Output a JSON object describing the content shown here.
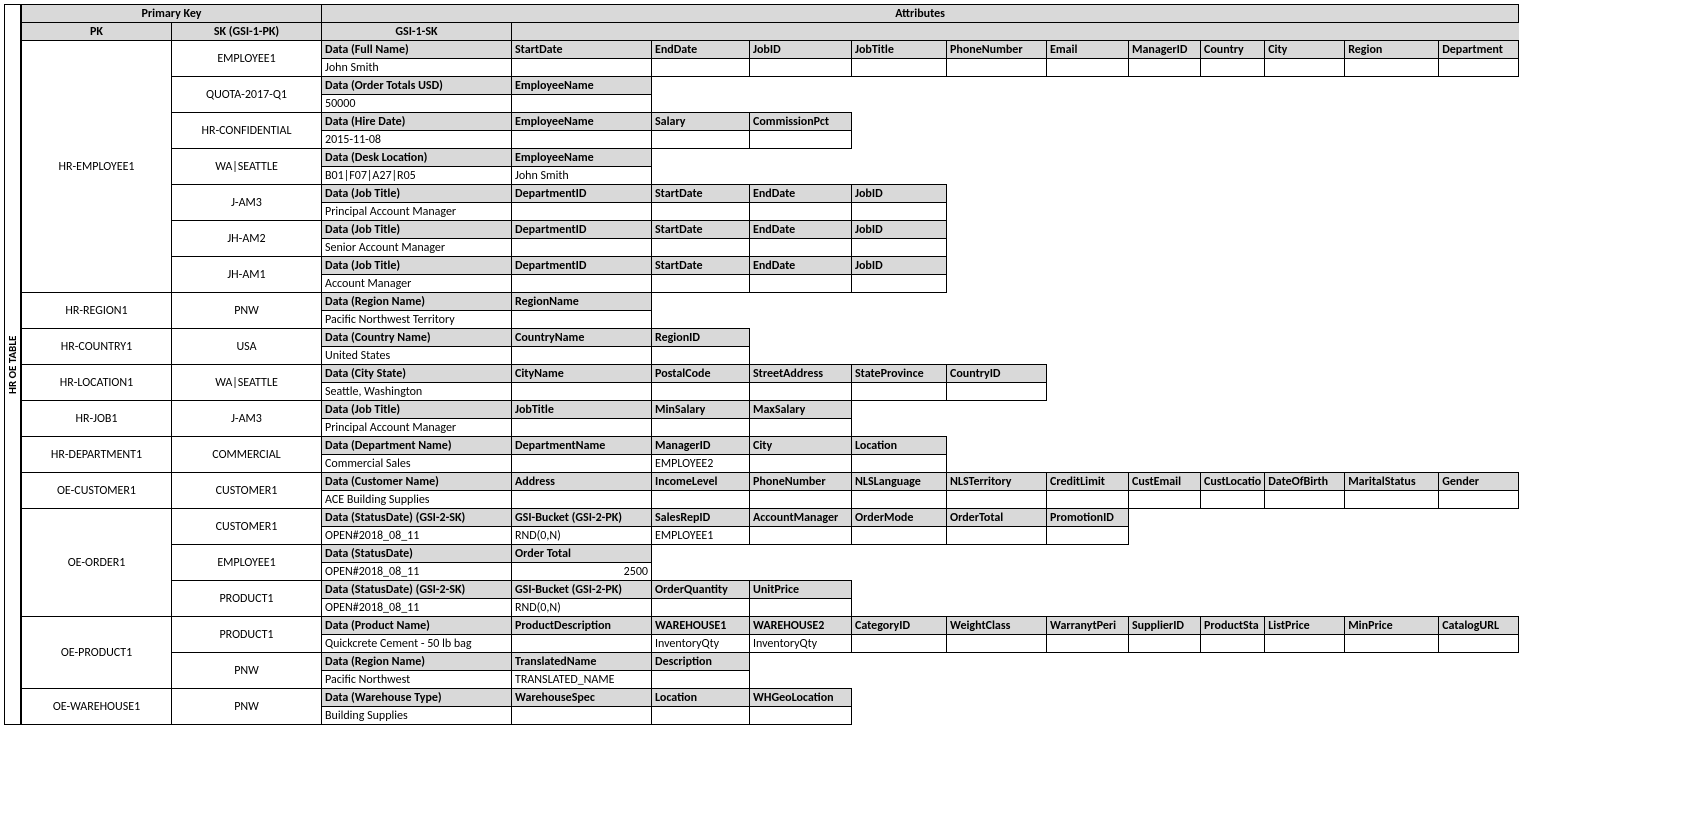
{
  "vlabel": "HR OE TABLE",
  "top": {
    "pk_group": "Primary Key",
    "attr_group": "Attributes",
    "pk": "PK",
    "sk": "SK (GSI-1-PK)",
    "gsi1sk": "GSI-1-SK"
  },
  "groups": [
    {
      "pk": "HR-EMPLOYEE1",
      "rows": [
        {
          "sk": "EMPLOYEE1",
          "h": [
            "Data (Full Name)",
            "StartDate",
            "EndDate",
            "JobID",
            "JobTitle",
            "PhoneNumber",
            "Email",
            "ManagerID",
            "Country",
            "City",
            "Region",
            "Department"
          ],
          "v": [
            "John Smith",
            "",
            "",
            "",
            "",
            "",
            "",
            "",
            "",
            "",
            "",
            ""
          ]
        },
        {
          "sk": "QUOTA-2017-Q1",
          "h": [
            "Data (Order Totals USD)",
            "EmployeeName"
          ],
          "v": [
            "50000",
            ""
          ]
        },
        {
          "sk": "HR-CONFIDENTIAL",
          "h": [
            "Data (Hire Date)",
            "EmployeeName",
            "Salary",
            "CommissionPct"
          ],
          "v": [
            "2015-11-08",
            "",
            "",
            ""
          ]
        },
        {
          "sk": "WA|SEATTLE",
          "h": [
            "Data (Desk Location)",
            "EmployeeName"
          ],
          "v": [
            "B01|F07|A27|R05",
            "John Smith"
          ]
        },
        {
          "sk": "J-AM3",
          "h": [
            "Data (Job Title)",
            "DepartmentID",
            "StartDate",
            "EndDate",
            "JobID"
          ],
          "v": [
            "Principal Account Manager",
            "",
            "",
            "",
            ""
          ]
        },
        {
          "sk": "JH-AM2",
          "h": [
            "Data (Job Title)",
            "DepartmentID",
            "StartDate",
            "EndDate",
            "JobID"
          ],
          "v": [
            "Senior Account Manager",
            "",
            "",
            "",
            ""
          ]
        },
        {
          "sk": "JH-AM1",
          "h": [
            "Data (Job Title)",
            "DepartmentID",
            "StartDate",
            "EndDate",
            "JobID"
          ],
          "v": [
            "Account Manager",
            "",
            "",
            "",
            ""
          ]
        }
      ]
    },
    {
      "pk": "HR-REGION1",
      "rows": [
        {
          "sk": "PNW",
          "h": [
            "Data (Region Name)",
            "RegionName"
          ],
          "v": [
            "Pacific Northwest Territory",
            ""
          ]
        }
      ]
    },
    {
      "pk": "HR-COUNTRY1",
      "rows": [
        {
          "sk": "USA",
          "h": [
            "Data (Country Name)",
            "CountryName",
            "RegionID"
          ],
          "v": [
            "United States",
            "",
            ""
          ]
        }
      ]
    },
    {
      "pk": "HR-LOCATION1",
      "rows": [
        {
          "sk": "WA|SEATTLE",
          "h": [
            "Data (City State)",
            "CityName",
            "PostalCode",
            "StreetAddress",
            "StateProvince",
            "CountryID"
          ],
          "v": [
            "Seattle, Washington",
            "",
            "",
            "",
            "",
            ""
          ]
        }
      ]
    },
    {
      "pk": "HR-JOB1",
      "rows": [
        {
          "sk": "J-AM3",
          "h": [
            "Data (Job Title)",
            "JobTitle",
            "MinSalary",
            "MaxSalary"
          ],
          "v": [
            "Principal Account Manager",
            "",
            "",
            ""
          ]
        }
      ]
    },
    {
      "pk": "HR-DEPARTMENT1",
      "rows": [
        {
          "sk": "COMMERCIAL",
          "h": [
            "Data (Department Name)",
            "DepartmentName",
            "ManagerID",
            "City",
            "Location"
          ],
          "v": [
            "Commercial Sales",
            "",
            "EMPLOYEE2",
            "",
            ""
          ]
        }
      ]
    },
    {
      "pk": "OE-CUSTOMER1",
      "rows": [
        {
          "sk": "CUSTOMER1",
          "h": [
            "Data (Customer Name)",
            "Address",
            "IncomeLevel",
            "PhoneNumber",
            "NLSLanguage",
            "NLSTerritory",
            "CreditLimit",
            "CustEmail",
            "CustLocatio",
            "DateOfBirth",
            "MaritalStatus",
            "Gender"
          ],
          "v": [
            "ACE Building Supplies",
            "",
            "",
            "",
            "",
            "",
            "",
            "",
            "",
            "",
            "",
            ""
          ]
        }
      ]
    },
    {
      "pk": "OE-ORDER1",
      "rows": [
        {
          "sk": "CUSTOMER1",
          "h": [
            "Data (StatusDate) (GSI-2-SK)",
            "GSI-Bucket (GSI-2-PK)",
            "SalesRepID",
            "AccountManager",
            "OrderMode",
            "OrderTotal",
            "PromotionID"
          ],
          "v": [
            "OPEN#2018_08_11",
            "RND(0,N)",
            "EMPLOYEE1",
            "",
            "",
            "",
            ""
          ]
        },
        {
          "sk": "EMPLOYEE1",
          "h": [
            "Data (StatusDate)",
            "Order Total"
          ],
          "v": [
            "OPEN#2018_08_11",
            "2500"
          ],
          "ralign": [
            1
          ]
        },
        {
          "sk": "PRODUCT1",
          "h": [
            "Data (StatusDate) (GSI-2-SK)",
            "GSI-Bucket (GSI-2-PK)",
            "OrderQuantity",
            "UnitPrice"
          ],
          "v": [
            "OPEN#2018_08_11",
            "RND(0,N)",
            "",
            ""
          ]
        }
      ]
    },
    {
      "pk": "OE-PRODUCT1",
      "rows": [
        {
          "sk": "PRODUCT1",
          "h": [
            "Data (Product Name)",
            "ProductDescription",
            "WAREHOUSE1",
            "WAREHOUSE2",
            "CategoryID",
            "WeightClass",
            "WarranytPeri",
            "SupplierID",
            "ProductSta",
            "ListPrice",
            "MinPrice",
            "CatalogURL"
          ],
          "v": [
            "Quickcrete Cement - 50 lb bag",
            "",
            "InventoryQty",
            "InventoryQty",
            "",
            "",
            "",
            "",
            "",
            "",
            "",
            ""
          ]
        },
        {
          "sk": "PNW",
          "h": [
            "Data (Region Name)",
            "TranslatedName",
            "Description"
          ],
          "v": [
            "Pacific Northwest",
            "TRANSLATED_NAME",
            ""
          ]
        }
      ]
    },
    {
      "pk": "OE-WAREHOUSE1",
      "rows": [
        {
          "sk": "PNW",
          "h": [
            "Data (Warehouse Type)",
            "WarehouseSpec",
            "Location",
            "WHGeoLocation"
          ],
          "v": [
            "Building Supplies",
            "",
            "",
            ""
          ]
        }
      ]
    }
  ]
}
